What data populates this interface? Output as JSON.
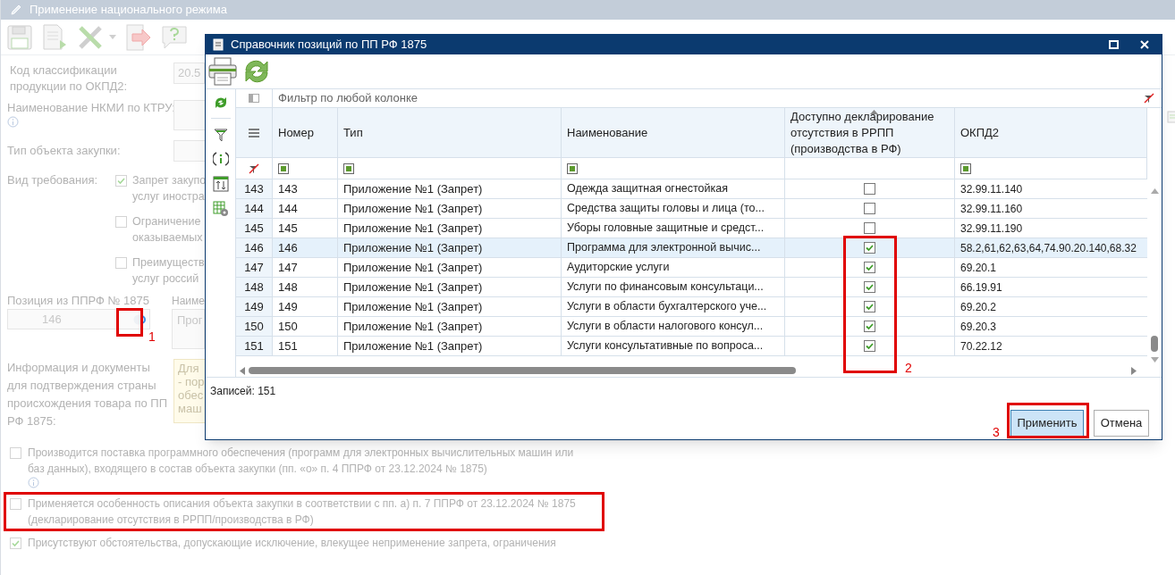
{
  "window": {
    "title": "Применение национального режима"
  },
  "form": {
    "okpd2": {
      "label": "Код классификации продукции по ОКПД2:",
      "value": "20.5"
    },
    "nkmi": {
      "label": "Наименование НКМИ по КТРУ:"
    },
    "object_type": {
      "label": "Тип объекта закупки:"
    },
    "requirement": {
      "label": "Вид требования:",
      "options": [
        {
          "lines": [
            "Запрет закупо",
            "услуг иностра"
          ],
          "checked": true
        },
        {
          "lines": [
            "Ограничение",
            "оказываемых"
          ],
          "checked": false
        },
        {
          "lines": [
            "Преимуществ",
            "услуг россий"
          ],
          "checked": false
        }
      ]
    },
    "position": {
      "label": "Позиция из ППРФ № 1875",
      "value": "146"
    },
    "position_name": {
      "label": "Наиме",
      "value": "Прог"
    },
    "documents": {
      "label": "Информация и документы для подтверждения страны происхождения товара по ПП РФ 1875:",
      "lines": [
        "Для",
        "- пор",
        "обес",
        "маш"
      ]
    },
    "flags": [
      {
        "text": "Производится поставка программного обеспечения (программ для электронных вычислительных машин или баз данных), входящего в состав объекта закупки (пп. «о» п. 4 ППРФ от 23.12.2024 № 1875)",
        "checked": false,
        "info": true,
        "highlighted": false
      },
      {
        "text": "Применяется особенность описания объекта закупки в соответствии с пп. а) п. 7 ППРФ от 23.12.2024 № 1875 (декларирование отсутствия в РРПП/производства в РФ)",
        "checked": false,
        "info": false,
        "highlighted": true
      },
      {
        "text": "Присутствуют обстоятельства, допускающие исключение, влекущее неприменение запрета, ограничения",
        "checked": true,
        "info": false,
        "highlighted": false
      }
    ]
  },
  "dialog": {
    "title": "Справочник позиций по ПП РФ 1875",
    "filter_placeholder": "Фильтр по любой колонке",
    "columns": [
      {
        "label": "Номер",
        "filter": true,
        "sorted": false
      },
      {
        "label": "Тип",
        "filter": true,
        "sorted": false
      },
      {
        "label": "Наименование",
        "filter": true,
        "sorted": false
      },
      {
        "label": "Доступно декларирование отсутствия в РРПП (производства в РФ)",
        "filter": false,
        "sorted": true
      },
      {
        "label": "ОКПД2",
        "filter": true,
        "sorted": false
      }
    ],
    "rows": [
      {
        "row_number": "143",
        "number": "143",
        "type": "Приложение №1 (Запрет)",
        "name": "Одежда защитная огнестойкая",
        "declaration": false,
        "okpd2": "32.99.11.140",
        "selected": false
      },
      {
        "row_number": "144",
        "number": "144",
        "type": "Приложение №1 (Запрет)",
        "name": "Средства защиты головы и лица (то...",
        "declaration": false,
        "okpd2": "32.99.11.160",
        "selected": false
      },
      {
        "row_number": "145",
        "number": "145",
        "type": "Приложение №1 (Запрет)",
        "name": "Уборы головные защитные и средст...",
        "declaration": false,
        "okpd2": "32.99.11.190",
        "selected": false
      },
      {
        "row_number": "146",
        "number": "146",
        "type": "Приложение №1 (Запрет)",
        "name": "Программа для электронной вычис...",
        "declaration": true,
        "okpd2": "58.2,61,62,63,64,74.90.20.140,68.32",
        "selected": true
      },
      {
        "row_number": "147",
        "number": "147",
        "type": "Приложение №1 (Запрет)",
        "name": "Аудиторские услуги",
        "declaration": true,
        "okpd2": "69.20.1",
        "selected": false
      },
      {
        "row_number": "148",
        "number": "148",
        "type": "Приложение №1 (Запрет)",
        "name": "Услуги по финансовым консультаци...",
        "declaration": true,
        "okpd2": "66.19.91",
        "selected": false
      },
      {
        "row_number": "149",
        "number": "149",
        "type": "Приложение №1 (Запрет)",
        "name": "Услуги в области бухгалтерского уче...",
        "declaration": true,
        "okpd2": "69.20.2",
        "selected": false
      },
      {
        "row_number": "150",
        "number": "150",
        "type": "Приложение №1 (Запрет)",
        "name": "Услуги в области налогового консул...",
        "declaration": true,
        "okpd2": "69.20.3",
        "selected": false
      },
      {
        "row_number": "151",
        "number": "151",
        "type": "Приложение №1 (Запрет)",
        "name": "Услуги консультативные по вопроса...",
        "declaration": true,
        "okpd2": "70.22.12",
        "selected": false
      }
    ],
    "records": "Записей: 151",
    "buttons": [
      {
        "label": "Применить",
        "kind": "primary"
      },
      {
        "label": "Отмена",
        "kind": "default"
      }
    ]
  },
  "annotations": [
    {
      "label": "1"
    },
    {
      "label": "2"
    },
    {
      "label": "3"
    }
  ]
}
